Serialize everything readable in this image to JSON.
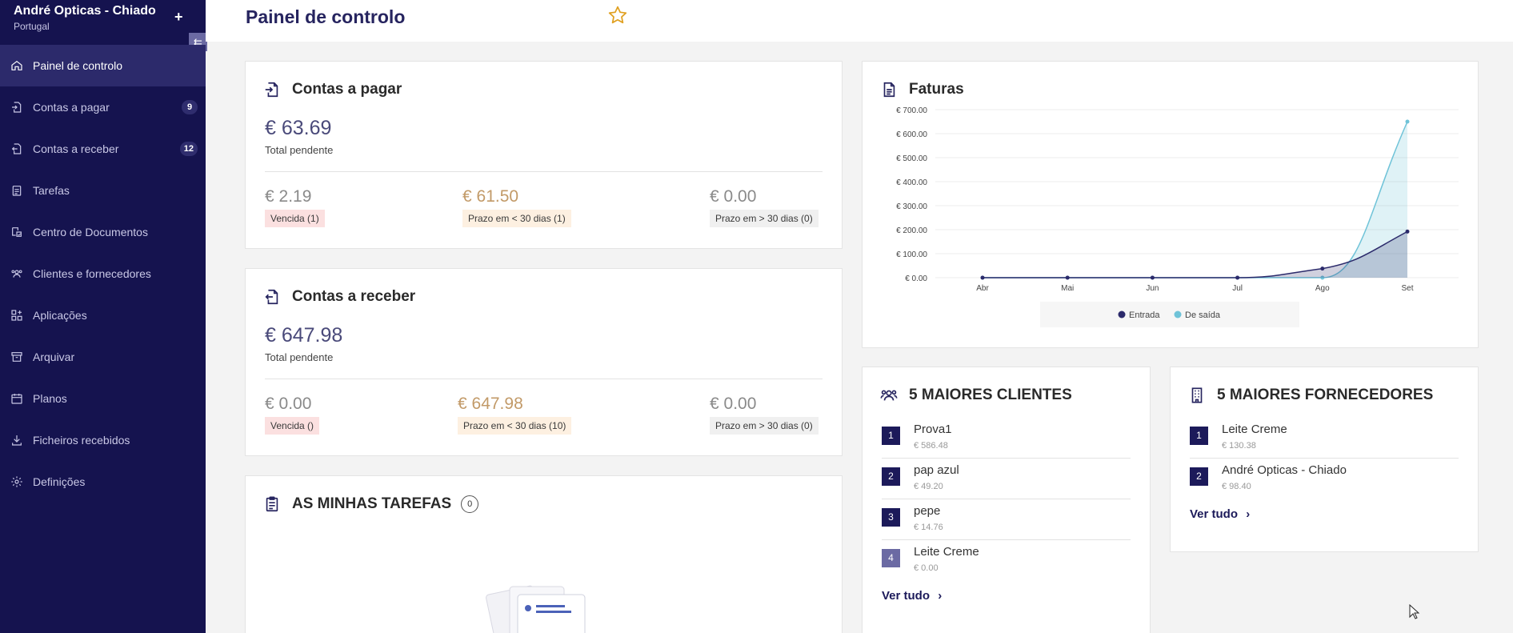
{
  "sidebar": {
    "company_name": "André Opticas - Chiado",
    "company_country": "Portugal",
    "plus_label": "+",
    "collapse_label": "⇇",
    "items": [
      {
        "label": "Painel de controlo",
        "icon": "home-icon",
        "badge": ""
      },
      {
        "label": "Contas a pagar",
        "icon": "file-import-icon",
        "badge": "9"
      },
      {
        "label": "Contas a receber",
        "icon": "file-export-icon",
        "badge": "12"
      },
      {
        "label": "Tarefas",
        "icon": "clipboard-icon",
        "badge": ""
      },
      {
        "label": "Centro de Documentos",
        "icon": "documents-icon",
        "badge": ""
      },
      {
        "label": "Clientes e fornecedores",
        "icon": "users-icon",
        "badge": ""
      },
      {
        "label": "Aplicações",
        "icon": "apps-icon",
        "badge": ""
      },
      {
        "label": "Arquivar",
        "icon": "archive-icon",
        "badge": ""
      },
      {
        "label": "Planos",
        "icon": "calendar-icon",
        "badge": ""
      },
      {
        "label": "Ficheiros recebidos",
        "icon": "download-icon",
        "badge": ""
      },
      {
        "label": "Definições",
        "icon": "gear-icon",
        "badge": ""
      }
    ]
  },
  "header": {
    "title": "Painel de controlo",
    "favorite_icon": "star-icon"
  },
  "payables": {
    "title": "Contas a pagar",
    "total": "€ 63.69",
    "total_label": "Total pendente",
    "overdue_amount": "€ 2.19",
    "overdue_label": "Vencida (1)",
    "soon_amount": "€ 61.50",
    "soon_label": "Prazo em < 30 dias (1)",
    "later_amount": "€ 0.00",
    "later_label": "Prazo em > 30 dias (0)"
  },
  "receivables": {
    "title": "Contas a receber",
    "total": "€ 647.98",
    "total_label": "Total pendente",
    "overdue_amount": "€ 0.00",
    "overdue_label": "Vencida ()",
    "soon_amount": "€ 647.98",
    "soon_label": "Prazo em < 30 dias (10)",
    "later_amount": "€ 0.00",
    "later_label": "Prazo em > 30 dias (0)"
  },
  "tasks": {
    "title": "AS MINHAS TAREFAS",
    "count": "0"
  },
  "invoices": {
    "title": "Faturas"
  },
  "top_clients": {
    "title": "5 MAIORES CLIENTES",
    "items": [
      {
        "rank": "1",
        "name": "Prova1",
        "value": "€ 586.48"
      },
      {
        "rank": "2",
        "name": "pap azul",
        "value": "€ 49.20"
      },
      {
        "rank": "3",
        "name": "pepe",
        "value": "€ 14.76"
      },
      {
        "rank": "4",
        "name": "Leite Creme",
        "value": "€ 0.00"
      }
    ],
    "see_all": "Ver tudo"
  },
  "top_suppliers": {
    "title": "5 MAIORES FORNECEDORES",
    "items": [
      {
        "rank": "1",
        "name": "Leite Creme",
        "value": "€ 130.38"
      },
      {
        "rank": "2",
        "name": "André Opticas - Chiado",
        "value": "€ 98.40"
      }
    ],
    "see_all": "Ver tudo"
  },
  "colors": {
    "sidebar": "#15134f",
    "accent": "#26245f",
    "entrada": "#2b2a6b",
    "saida": "#6fc3d8"
  },
  "chart_data": {
    "type": "area",
    "title": "",
    "categories": [
      "Abr",
      "Mai",
      "Jun",
      "Jul",
      "Ago",
      "Set"
    ],
    "y_tick_labels": [
      "€ 0.00",
      "€ 100.00",
      "€ 200.00",
      "€ 300.00",
      "€ 400.00",
      "€ 500.00",
      "€ 600.00",
      "€ 700.00"
    ],
    "ylim": [
      0,
      700
    ],
    "grid": true,
    "legend_position": "bottom",
    "series": [
      {
        "name": "Entrada",
        "values": [
          0,
          0,
          0,
          0,
          38,
          192
        ]
      },
      {
        "name": "De saída",
        "values": [
          0,
          0,
          0,
          0,
          0,
          650
        ]
      }
    ]
  }
}
